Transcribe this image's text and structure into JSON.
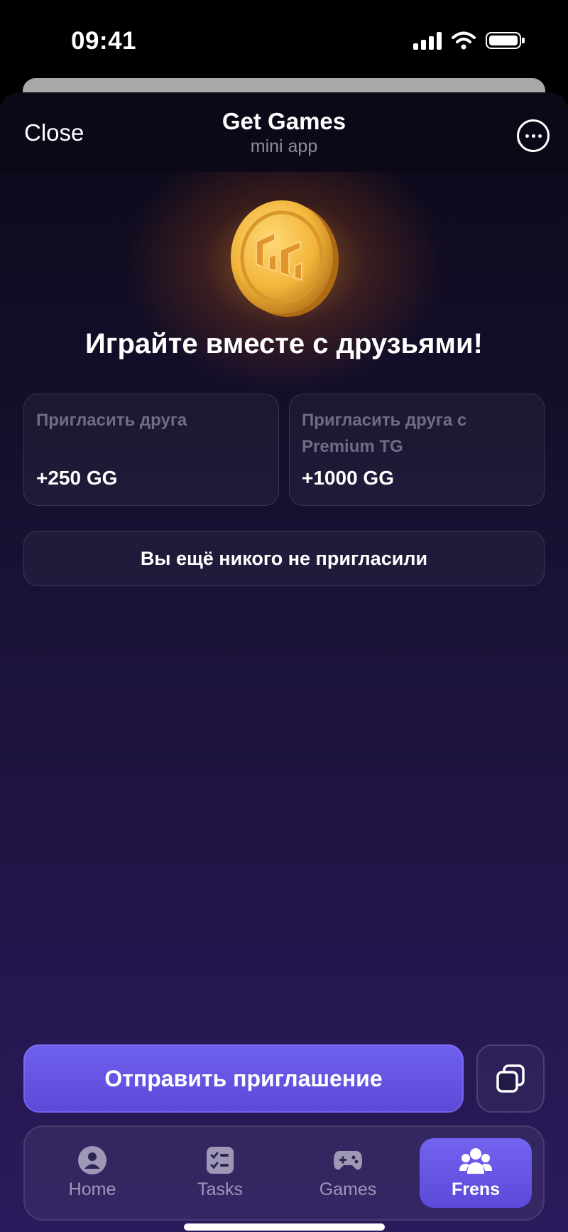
{
  "status_bar": {
    "time": "09:41"
  },
  "header": {
    "close_label": "Close",
    "title": "Get Games",
    "subtitle": "mini app"
  },
  "hero": {
    "headline": "Играйте вместе с друзьями!"
  },
  "rewards": [
    {
      "label": "Пригласить друга",
      "value": "+250 GG"
    },
    {
      "label": "Пригласить друга с Premium TG",
      "value": "+1000 GG"
    }
  ],
  "empty_state": "Вы ещё никого не пригласили",
  "actions": {
    "invite_label": "Отправить приглашение"
  },
  "tabs": [
    {
      "label": "Home",
      "icon": "home-icon",
      "active": false
    },
    {
      "label": "Tasks",
      "icon": "tasks-icon",
      "active": false
    },
    {
      "label": "Games",
      "icon": "gamepad-icon",
      "active": false
    },
    {
      "label": "Frens",
      "icon": "friends-icon",
      "active": true
    }
  ],
  "colors": {
    "accent": "#6453e2",
    "background": "#1a1236",
    "coin": "#f2b53a"
  }
}
